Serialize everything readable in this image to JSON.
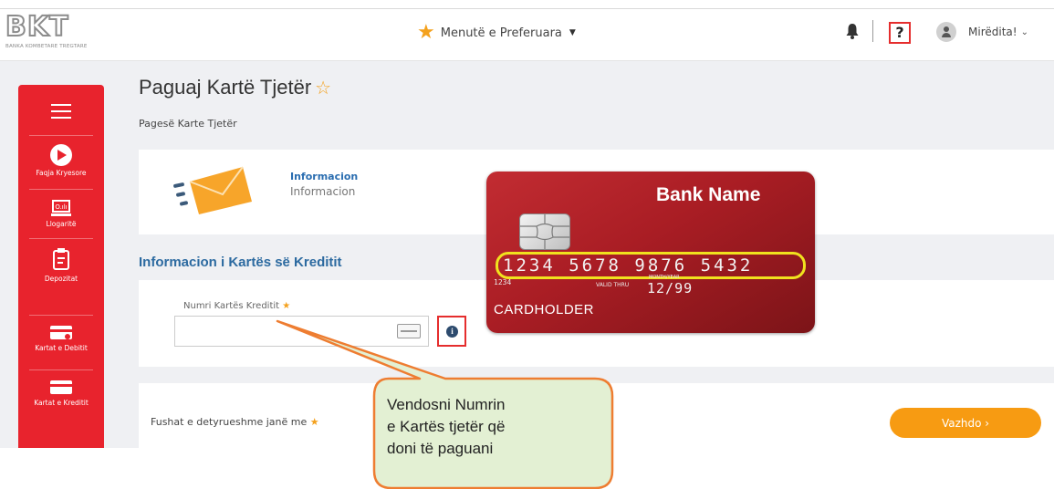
{
  "header": {
    "logo_text": "BKT",
    "logo_subtitle": "BANKA KOMBETARE TREGTARE",
    "favorites_label": "Menutë e Preferuara",
    "help_label": "?",
    "greeting": "Mirëdita!",
    "icons": [
      "star-icon",
      "caret-down-icon",
      "bell-icon",
      "avatar-icon",
      "chevron-down-icon"
    ]
  },
  "sidebar": {
    "items": [
      {
        "label": "Faqja Kryesore",
        "icon": "home-icon"
      },
      {
        "label": "Llogaritë",
        "icon": "accounts-icon"
      },
      {
        "label": "Depozitat",
        "icon": "deposits-icon"
      },
      {
        "label": "Kartat e Debitit",
        "icon": "debit-card-icon"
      },
      {
        "label": "Kartat e Kreditit",
        "icon": "credit-card-icon"
      }
    ]
  },
  "page": {
    "title": "Paguaj Kartë Tjetër",
    "subtitle": "Pagesë Karte Tjetër"
  },
  "info_panel": {
    "label": "Informacion",
    "text": "Informacion"
  },
  "form": {
    "section_title": "Informacion i Kartës së Kreditit",
    "card_number_label": "Numri Kartës Kreditit",
    "card_number_value": "",
    "required_note": "Fushat e detyrueshme janë me",
    "continue_button": "Vazhdo ›"
  },
  "card_overlay": {
    "bank_name": "Bank Name",
    "number": "1234 5678 9876 5432",
    "small_number": "1234",
    "valid_thru": "VALID THRU",
    "month_year": "MONTH/YEAR",
    "expiry": "12/99",
    "holder": "CARDHOLDER"
  },
  "callout": {
    "line1": "Vendosni Numrin",
    "line2": "e Kartës tjetër që",
    "line3": "doni të paguani"
  },
  "colors": {
    "brand_red": "#e8232d",
    "accent_orange": "#f79b12",
    "link_blue": "#2c6aa0",
    "callout_fill": "#e3f0d3",
    "callout_border": "#ee7d31"
  }
}
